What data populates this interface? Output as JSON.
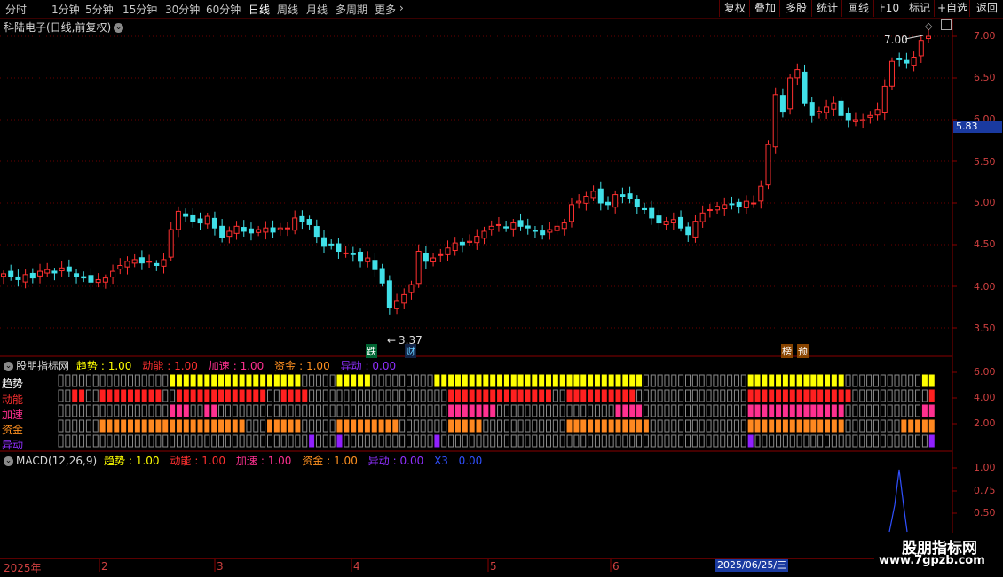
{
  "toolbar": {
    "timeframes": [
      "分时",
      "1分钟",
      "5分钟",
      "15分钟",
      "30分钟",
      "60分钟",
      "日线",
      "周线",
      "月线",
      "多周期",
      "更多"
    ],
    "active_timeframe": "日线",
    "right_buttons": [
      "复权",
      "叠加",
      "多股",
      "统计",
      "画线",
      "F10",
      "+自选",
      "返回"
    ],
    "mark_button": "标记"
  },
  "stock": {
    "title": "科陆电子(日线,前复权)",
    "current_price_tag": "5.83",
    "high_annotation": "7.00",
    "low_annotation": "3.37",
    "markers": [
      "跌",
      "财",
      "榜",
      "预"
    ]
  },
  "price_axis": [
    "7.00",
    "6.50",
    "6.00",
    "5.50",
    "5.00",
    "4.50",
    "4.00",
    "3.50"
  ],
  "indicator_panel": {
    "name": "股朋指标网",
    "legend": [
      {
        "label": "趋势",
        "value": "1.00",
        "color": "#ffff00"
      },
      {
        "label": "动能",
        "value": "1.00",
        "color": "#ff3030"
      },
      {
        "label": "加速",
        "value": "1.00",
        "color": "#ff3090"
      },
      {
        "label": "资金",
        "value": "1.00",
        "color": "#ff9020"
      },
      {
        "label": "异动",
        "value": "0.00",
        "color": "#9030ff"
      }
    ],
    "row_labels": [
      "趋势",
      "动能",
      "加速",
      "资金",
      "异动"
    ],
    "axis": [
      "6.00",
      "4.00",
      "2.00"
    ]
  },
  "macd_panel": {
    "name": "MACD(12,26,9)",
    "legend": [
      {
        "label": "趋势",
        "value": "1.00",
        "color": "#ffff00"
      },
      {
        "label": "动能",
        "value": "1.00",
        "color": "#ff3030"
      },
      {
        "label": "加速",
        "value": "1.00",
        "color": "#ff3090"
      },
      {
        "label": "资金",
        "value": "1.00",
        "color": "#ff9020"
      },
      {
        "label": "异动",
        "value": "0.00",
        "color": "#9030ff"
      },
      {
        "label": "X3",
        "value": "0.00",
        "color": "#3050ff"
      }
    ],
    "axis": [
      "1.00",
      "0.75",
      "0.50"
    ]
  },
  "date_axis": {
    "labels": [
      "2025年",
      "2",
      "3",
      "4",
      "5",
      "6"
    ],
    "selected_date": "2025/06/25/三"
  },
  "watermark": {
    "title": "股朋指标网",
    "url": "www.7gpzb.com"
  },
  "colors": {
    "up": "#ff3030",
    "down": "#40e0e8",
    "grid": "#6a0000",
    "accent": "#1a3aa0"
  }
}
